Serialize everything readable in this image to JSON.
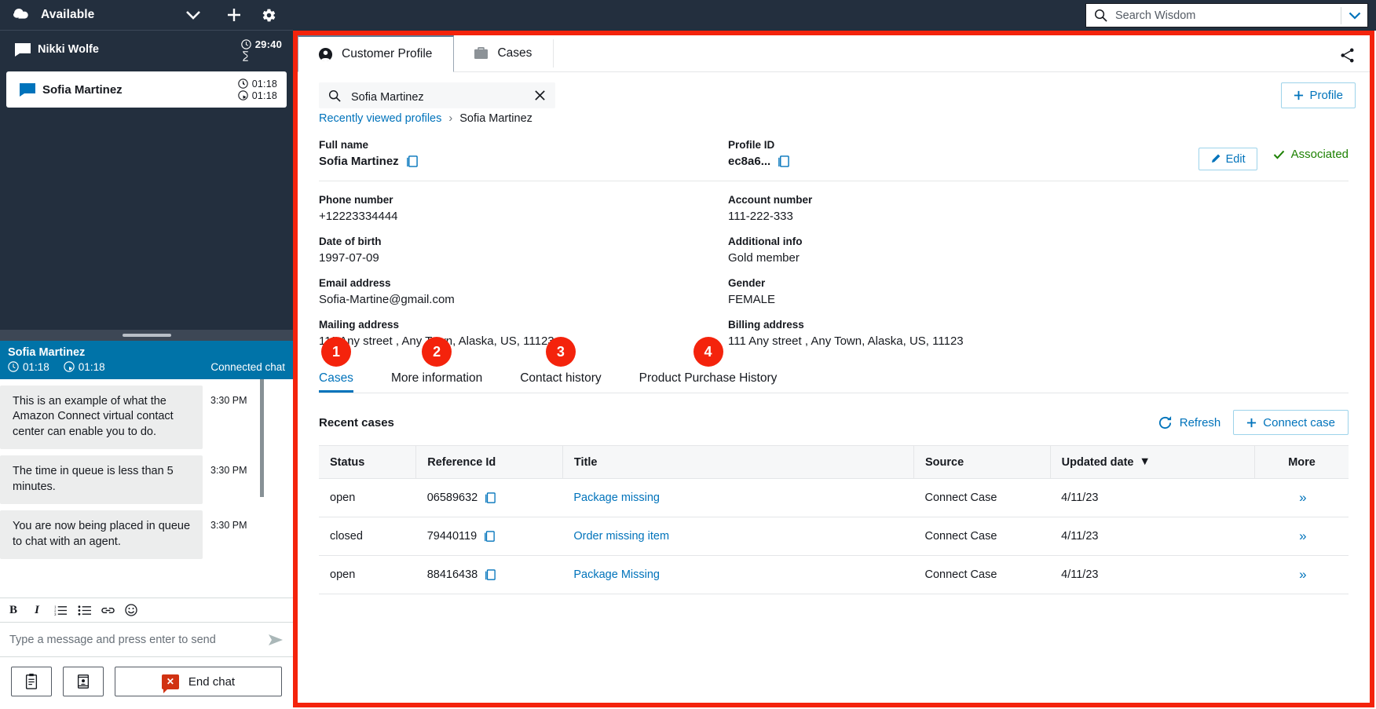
{
  "ccp": {
    "status": "Available",
    "icons": {
      "logo": "amazon-connect-logo",
      "chevron": "chevron-down-icon",
      "plus": "plus-icon",
      "gear": "gear-icon"
    },
    "contacts": [
      {
        "name": "Nikki Wolfe",
        "timer_clock": "29:40",
        "timer_second": "",
        "selected": false
      },
      {
        "name": "Sofia Martinez",
        "timer_clock": "01:18",
        "timer_second": "01:18",
        "selected": true
      }
    ],
    "chat": {
      "customer": "Sofia Martinez",
      "timer_clock": "01:18",
      "timer_second": "01:18",
      "status": "Connected chat",
      "messages": [
        {
          "text": "This is an example of what the Amazon Connect virtual contact center can enable you to do.",
          "time": "3:30 PM"
        },
        {
          "text": "The time in queue is less than 5 minutes.",
          "time": "3:30 PM"
        },
        {
          "text": "You are now being placed in queue to chat with an agent.",
          "time": "3:30 PM"
        }
      ],
      "toolbar": [
        "B",
        "I",
        "numbered-list-icon",
        "bullet-list-icon",
        "link-icon",
        "emoji-icon"
      ],
      "input_placeholder": "Type a message and press enter to send",
      "footer": {
        "quick_responses_label": "quick-responses-icon",
        "contact_card_label": "contact-card-icon",
        "end_chat_label": "End chat"
      }
    }
  },
  "topbar": {
    "search_placeholder": "Search Wisdom"
  },
  "tabs": [
    {
      "label": "Customer Profile",
      "icon": "person-icon",
      "active": true
    },
    {
      "label": "Cases",
      "icon": "briefcase-icon",
      "active": false
    }
  ],
  "profile_search": {
    "value": "Sofia Martinez",
    "clear_label": "clear-icon"
  },
  "add_profile_button": "Profile",
  "breadcrumb": {
    "root": "Recently viewed profiles",
    "separator": "›",
    "current": "Sofia Martinez"
  },
  "actions": {
    "edit_label": "Edit",
    "associated_label": "Associated",
    "associated_color": "#1d8102"
  },
  "fields": {
    "row1": [
      {
        "label": "Full name",
        "value": "Sofia Martinez",
        "bold": true,
        "copy": true
      },
      {
        "label": "Profile ID",
        "value": "ec8a6...",
        "bold": true,
        "copy": true
      }
    ],
    "left": [
      {
        "label": "Phone number",
        "value": "+12223334444"
      },
      {
        "label": "Date of birth",
        "value": "1997-07-09"
      },
      {
        "label": "Email address",
        "value": "Sofia-Martine@gmail.com"
      },
      {
        "label": "Mailing address",
        "value": "111 Any street , Any Town, Alaska, US, 11123"
      }
    ],
    "right": [
      {
        "label": "Account number",
        "value": "111-222-333"
      },
      {
        "label": "Additional info",
        "value": "Gold member"
      },
      {
        "label": "Gender",
        "value": "FEMALE"
      },
      {
        "label": "Billing address",
        "value": "111 Any street , Any Town, Alaska, US, 11123"
      }
    ]
  },
  "subtabs": [
    {
      "badge": "1",
      "label": "Cases",
      "active": true
    },
    {
      "badge": "2",
      "label": "More information",
      "active": false
    },
    {
      "badge": "3",
      "label": "Contact history",
      "active": false
    },
    {
      "badge": "4",
      "label": "Product Purchase History",
      "active": false
    }
  ],
  "cases_section": {
    "title": "Recent cases",
    "refresh_label": "Refresh",
    "connect_case_label": "Connect case",
    "columns": [
      "Status",
      "Reference Id",
      "Title",
      "Source",
      "Updated date",
      "More"
    ],
    "sorted_column": "Updated date",
    "rows": [
      {
        "status": "open",
        "reference_id": "06589632",
        "title": "Package missing",
        "source": "Connect Case",
        "updated_date": "4/11/23",
        "more": "»"
      },
      {
        "status": "closed",
        "reference_id": "79440119",
        "title": "Order missing item",
        "source": "Connect Case",
        "updated_date": "4/11/23",
        "more": "»"
      },
      {
        "status": "open",
        "reference_id": "88416438",
        "title": "Package Missing",
        "source": "Connect Case",
        "updated_date": "4/11/23",
        "more": "»"
      }
    ]
  },
  "colors": {
    "accent_blue": "#0073bb",
    "chat_header": "#0073a8",
    "highlight_red": "#f4230c",
    "dark_nav": "#232f3e"
  }
}
